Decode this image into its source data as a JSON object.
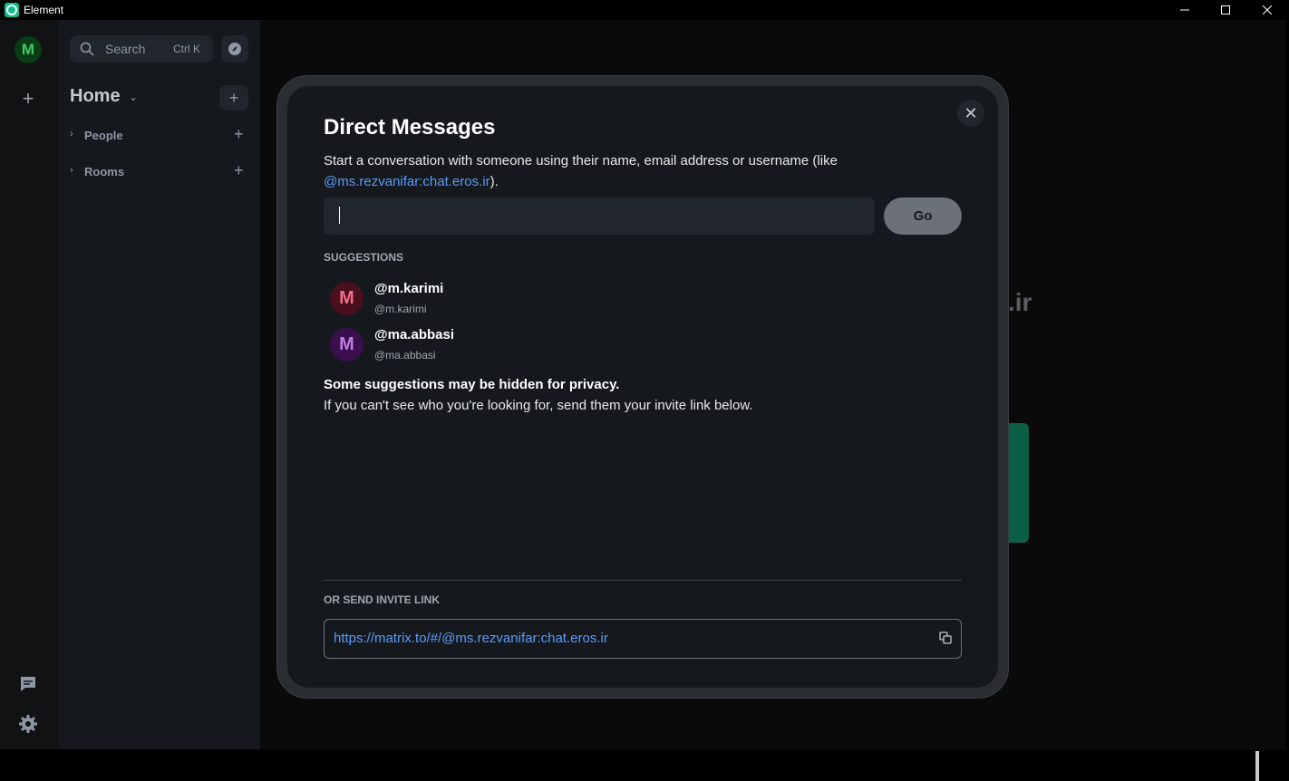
{
  "window": {
    "title": "Element",
    "min_glyph": "—",
    "max_glyph": "☐",
    "close_glyph": "✕"
  },
  "spaces": {
    "user_initial": "M",
    "add_glyph": "+"
  },
  "roomlist": {
    "search_label": "Search",
    "search_shortcut": "Ctrl K",
    "home_title": "Home",
    "home_chevron": "⌄",
    "home_add": "+",
    "sections": [
      {
        "name": "People",
        "chevron": "›",
        "add": "+"
      },
      {
        "name": "Rooms",
        "chevron": "›",
        "add": "+"
      }
    ]
  },
  "background": {
    "partial_text": ".ir"
  },
  "dialog": {
    "title": "Direct Messages",
    "description_prefix": "Start a conversation with someone using their name, email address or username (like ",
    "description_link": "@ms.rezvanifar:chat.eros.ir",
    "description_suffix": ").",
    "input_value": "",
    "go_label": "Go",
    "close_glyph": "✕",
    "suggestions_header": "SUGGESTIONS",
    "suggestions": [
      {
        "initial": "M",
        "name": "@m.karimi",
        "id": "@m.karimi",
        "avatar_bg": "#4a0f1c",
        "avatar_fg": "#f06d8b"
      },
      {
        "initial": "M",
        "name": "@ma.abbasi",
        "id": "@ma.abbasi",
        "avatar_bg": "#3a0f4d",
        "avatar_fg": "#c47be0"
      }
    ],
    "privacy_heading": "Some suggestions may be hidden for privacy.",
    "privacy_text": "If you can't see who you're looking for, send them your invite link below.",
    "invite_header": "OR SEND INVITE LINK",
    "invite_link": "https://matrix.to/#/@ms.rezvanifar:chat.eros.ir"
  },
  "colors": {
    "accent": "#0dbd8b",
    "link": "#5b9bf8",
    "dialog_bg": "#15191e"
  }
}
